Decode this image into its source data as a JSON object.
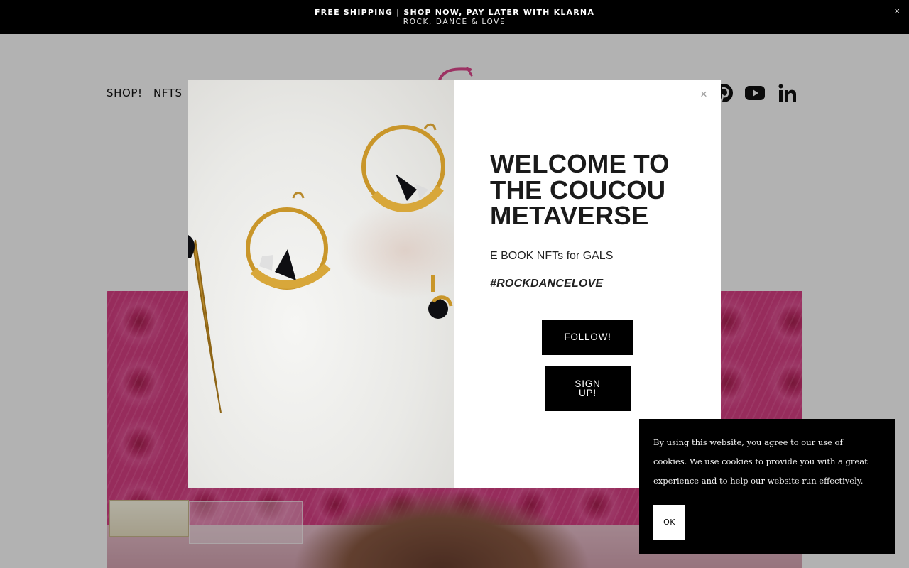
{
  "announcement": {
    "line1": "FREE SHIPPING  | SHOP NOW, PAY LATER WITH KLARNA",
    "line2": "ROCK, DANCE & LOVE",
    "close_label": "×"
  },
  "nav": {
    "items": [
      {
        "label": "SHOP!"
      },
      {
        "label": "NFTS"
      }
    ]
  },
  "social": {
    "icons": [
      "pinterest-icon",
      "youtube-icon",
      "linkedin-icon"
    ]
  },
  "modal": {
    "close_label": "×",
    "title": "WELCOME TO THE COUCOU METAVERSE",
    "subtitle": "E BOOK NFTs for GALS",
    "hashtag": "#ROCKDANCELOVE",
    "follow_label": "FOLLOW!",
    "signup_label": "SIGN UP!"
  },
  "cookie": {
    "message": "By using this website, you agree to our use of cookies. We use cookies to provide you with a great experience and to help our website run effectively.",
    "ok_label": "OK"
  },
  "colors": {
    "announcement_bg": "#000000",
    "button_bg": "#000000",
    "hero_pink": "#d93f85",
    "logo_pink": "#e0488f"
  }
}
